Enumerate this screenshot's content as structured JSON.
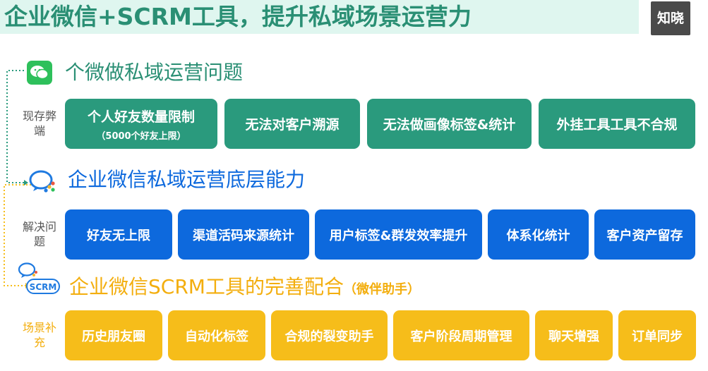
{
  "header": {
    "title": "企业微信+SCRM工具，提升私域场景运营力",
    "logo_text": "知晓"
  },
  "sections": {
    "problems": {
      "title": "个微做私域运营问题",
      "side_label": "现存弊端",
      "items": [
        {
          "label": "个人好友数量限制",
          "sub": "（5000个好友上限）"
        },
        {
          "label": "无法对客户溯源"
        },
        {
          "label": "无法做画像标签&统计"
        },
        {
          "label": "外挂工具工具不合规"
        }
      ]
    },
    "solutions": {
      "title": "企业微信私域运营底层能力",
      "side_label": "解决问题",
      "items": [
        {
          "label": "好友无上限"
        },
        {
          "label": "渠道活码来源统计"
        },
        {
          "label": "用户标签&群发效率提升"
        },
        {
          "label": "体系化统计"
        },
        {
          "label": "客户资产留存"
        }
      ]
    },
    "scenarios": {
      "title": "企业微信SCRM工具的完善配合",
      "title_note": "（微伴助手）",
      "side_label": "场景补充",
      "icon_text": "SCRM",
      "items": [
        {
          "label": "历史朋友圈"
        },
        {
          "label": "自动化标签"
        },
        {
          "label": "合规的裂变助手"
        },
        {
          "label": "客户阶段周期管理"
        },
        {
          "label": "聊天增强"
        },
        {
          "label": "订单同步"
        }
      ]
    }
  },
  "colors": {
    "green": "#2a9a7d",
    "blue": "#0d69dd",
    "gold": "#f6bd1a",
    "title_green": "#2a8f74"
  }
}
